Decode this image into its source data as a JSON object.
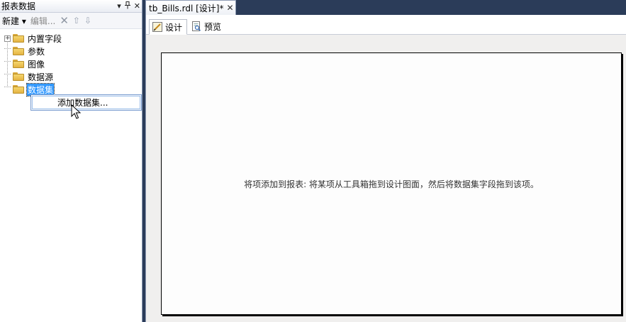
{
  "left_panel": {
    "title": "报表数据",
    "title_buttons": {
      "dropdown": "▾",
      "pin": "ᴾ",
      "close": "✕"
    },
    "toolbar": {
      "new_label": "新建",
      "new_arrow": "▾",
      "edit_label": "编辑...",
      "delete_glyph": "✕",
      "move_up_glyph": "⇧",
      "move_down_glyph": "⇩"
    },
    "tree": [
      {
        "label": "内置字段",
        "expander": "+"
      },
      {
        "label": "参数"
      },
      {
        "label": "图像"
      },
      {
        "label": "数据源"
      },
      {
        "label": "数据集",
        "selected": true
      }
    ],
    "context_menu": {
      "item": "添加数据集..."
    }
  },
  "document": {
    "tab_title": "tb_Bills.rdl [设计]*",
    "tab_close": "✕",
    "view_tabs": [
      {
        "label": "设计",
        "active": true
      },
      {
        "label": "预览",
        "active": false
      }
    ],
    "hint": "将项添加到报表: 将某项从工具箱拖到设计图面，然后将数据集字段拖到该项。"
  },
  "colors": {
    "background": "#2b3c59",
    "selection": "#3399ff",
    "folder": "#f6d66e"
  },
  "icons": {
    "folder": "folder-icon",
    "design": "design-icon",
    "preview": "preview-icon",
    "cursor": "mouse-cursor-icon"
  }
}
